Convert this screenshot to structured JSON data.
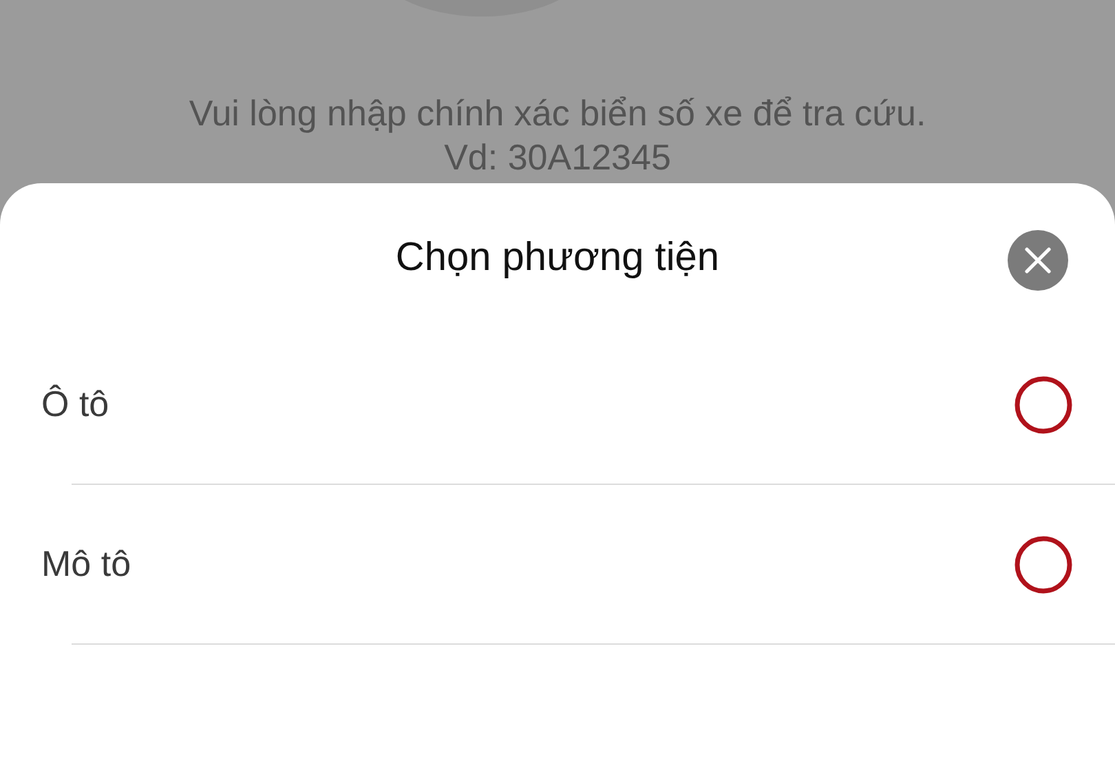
{
  "background": {
    "message": "Vui lòng nhập chính xác biển số xe để tra cứu.",
    "example": "Vd: 30A12345"
  },
  "sheet": {
    "title": "Chọn phương tiện",
    "options": [
      {
        "label": "Ô tô",
        "selected": false
      },
      {
        "label": "Mô tô",
        "selected": false
      }
    ]
  }
}
